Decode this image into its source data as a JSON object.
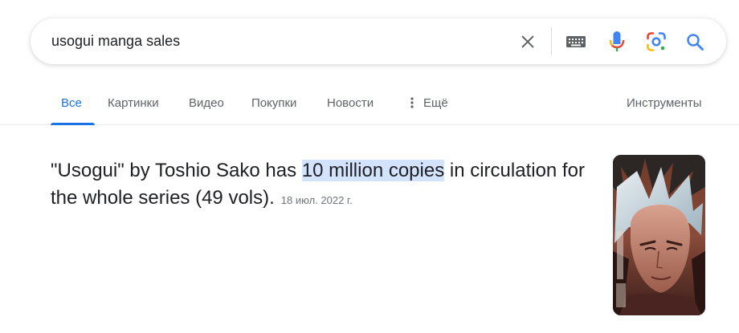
{
  "search": {
    "query": "usogui manga sales"
  },
  "tabs": [
    {
      "label": "Все"
    },
    {
      "label": "Картинки"
    },
    {
      "label": "Видео"
    },
    {
      "label": "Покупки"
    },
    {
      "label": "Новости"
    },
    {
      "label": "Ещё"
    }
  ],
  "tools_label": "Инструменты",
  "snippet": {
    "text_before": "\"Usogui\" by Toshio Sako has ",
    "highlight": "10 million copies",
    "text_after": " in circulation for the whole series (49 vols).",
    "date": "18 июл. 2022 г."
  },
  "colors": {
    "accent": "#1a73e8",
    "highlight_bg": "#d3e3fd",
    "text": "#202124",
    "muted": "#5f6368"
  },
  "icons": [
    "close-icon",
    "keyboard-icon",
    "microphone-icon",
    "google-lens-icon",
    "search-icon",
    "more-vert-icon"
  ]
}
